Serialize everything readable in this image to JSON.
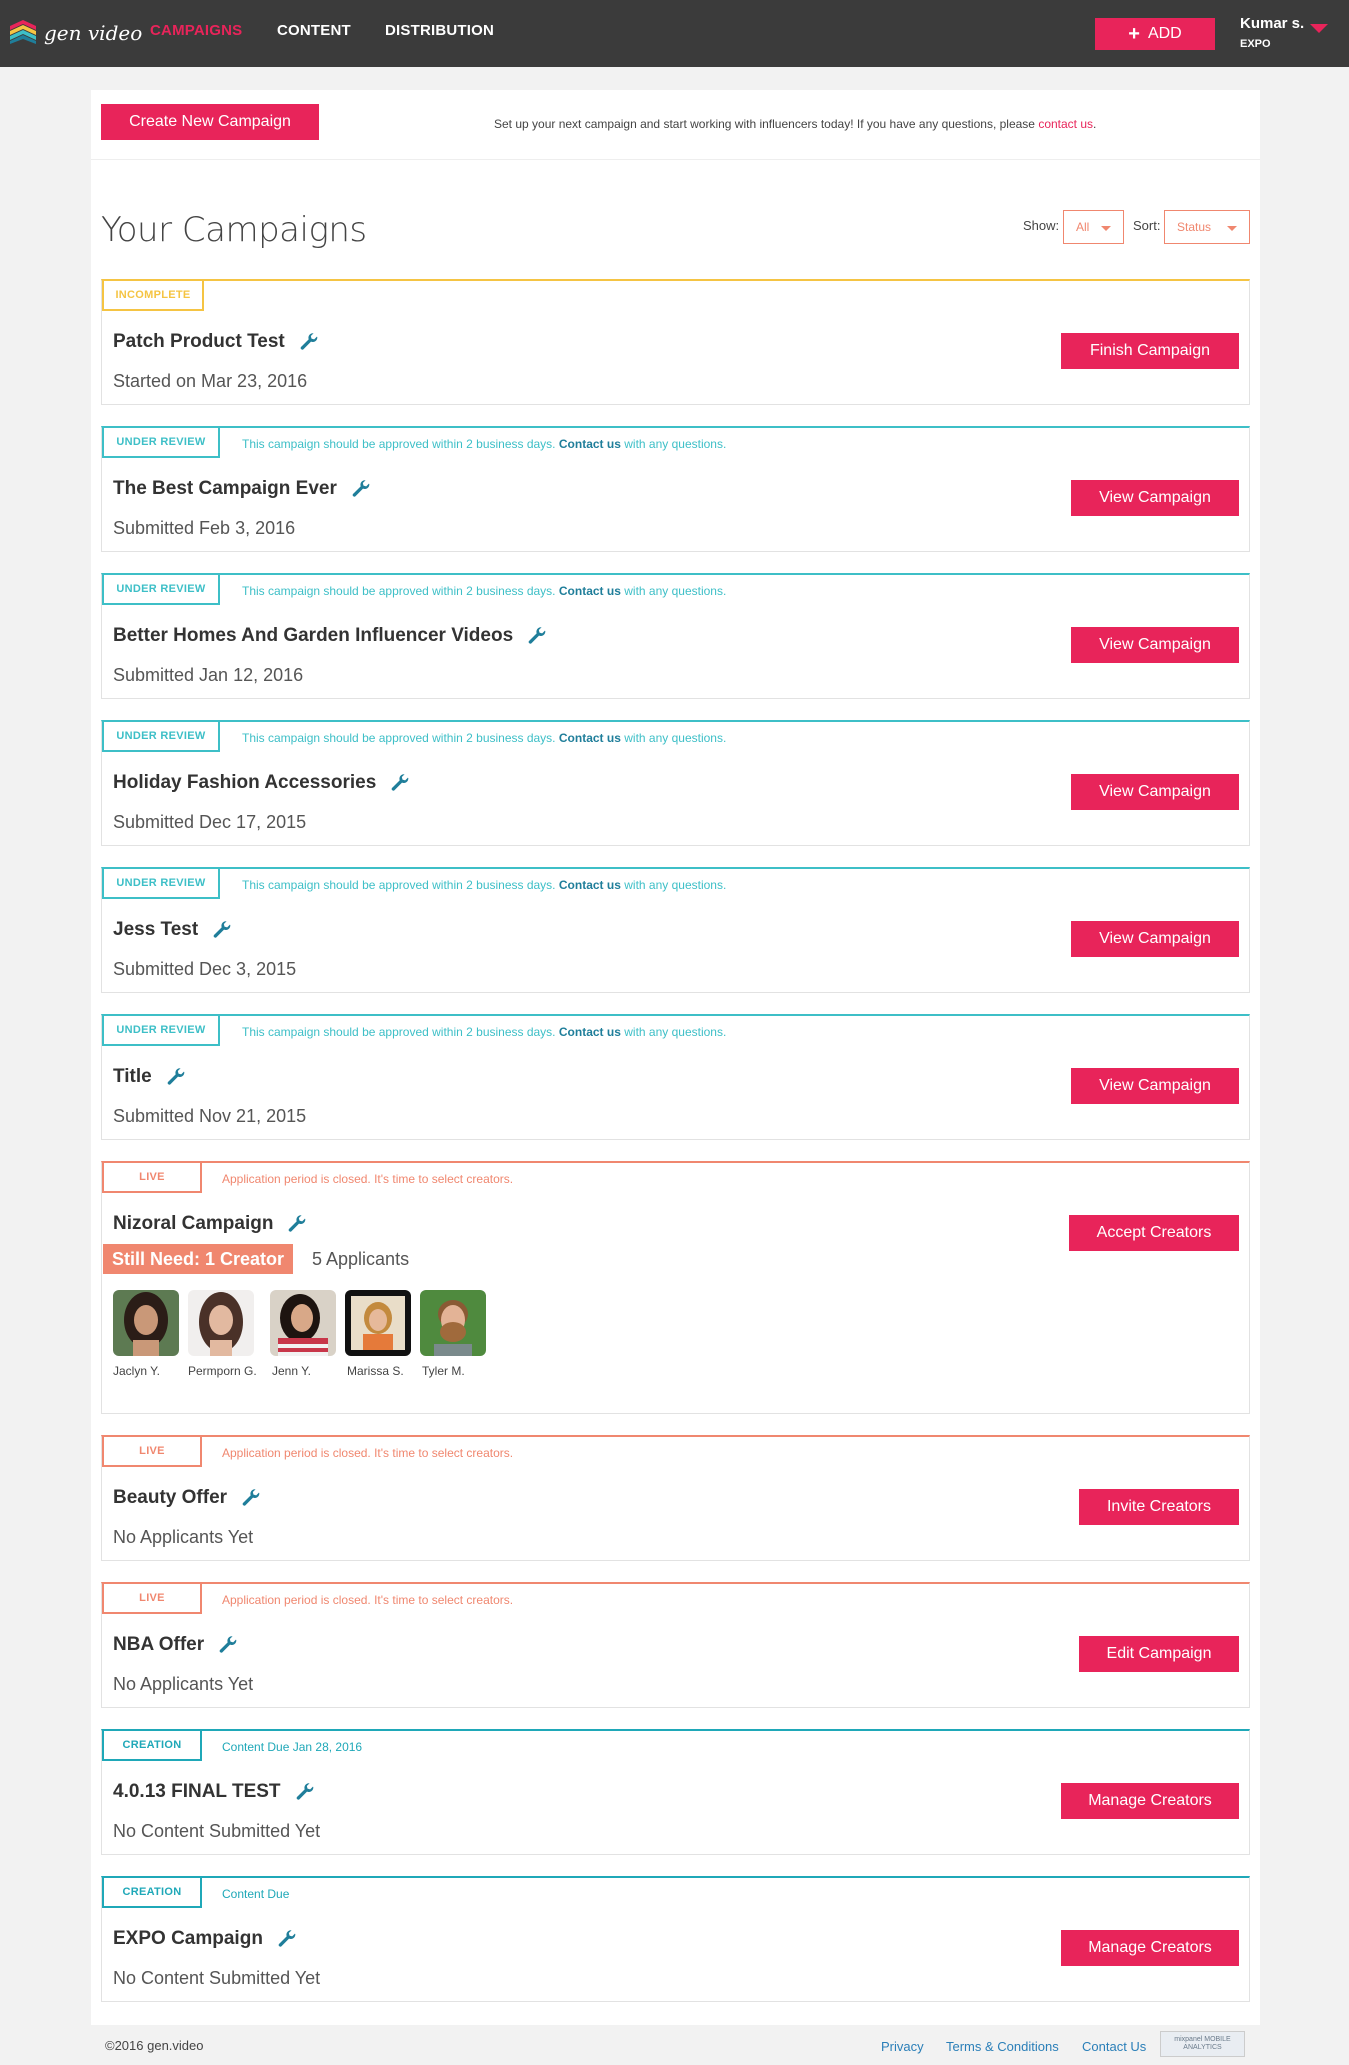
{
  "header": {
    "logo_text": "gen video",
    "nav": [
      "CAMPAIGNS",
      "CONTENT",
      "DISTRIBUTION"
    ],
    "add_label": "ADD",
    "user_name": "Kumar s.",
    "user_org": "EXPO"
  },
  "create": {
    "button_label": "Create New Campaign",
    "message": "Set up your next campaign and start working with influencers today! If you have any questions, please ",
    "message_link": "contact us",
    "message_end": "."
  },
  "campaigns_section": {
    "title": "Your Campaigns",
    "show_label": "Show:",
    "show_value": "All",
    "sort_label": "Sort:",
    "sort_value": "Status"
  },
  "campaigns": [
    {
      "status": "INCOMPLETE",
      "name": "Patch Product Test",
      "sub": "Started on Mar 23, 2016",
      "action": "Finish Campaign"
    },
    {
      "status": "UNDER REVIEW",
      "note": "This campaign should be approved within 2 business days.",
      "note_link": "Contact us",
      "note_end": "with any questions.",
      "name": "The Best Campaign Ever",
      "sub": "Submitted Feb 3, 2016",
      "action": "View Campaign"
    },
    {
      "status": "UNDER REVIEW",
      "note": "This campaign should be approved within 2 business days.",
      "note_link": "Contact us",
      "note_end": "with any questions.",
      "name": "Better Homes And Garden Influencer Videos",
      "sub": "Submitted Jan 12, 2016",
      "action": "View Campaign"
    },
    {
      "status": "UNDER REVIEW",
      "note": "This campaign should be approved within 2 business days.",
      "note_link": "Contact us",
      "note_end": "with any questions.",
      "name": "Holiday Fashion Accessories",
      "sub": "Submitted Dec 17, 2015",
      "action": "View Campaign"
    },
    {
      "status": "UNDER REVIEW",
      "note": "This campaign should be approved within 2 business days.",
      "note_link": "Contact us",
      "note_end": "with any questions.",
      "name": "Jess Test",
      "sub": "Submitted Dec 3, 2015",
      "action": "View Campaign"
    },
    {
      "status": "UNDER REVIEW",
      "note": "This campaign should be approved within 2 business days.",
      "note_link": "Contact us",
      "note_end": "with any questions.",
      "name": "Title",
      "sub": "Submitted Nov 21, 2015",
      "action": "View Campaign"
    },
    {
      "status": "LIVE",
      "note": "Application period is closed. It's time to select creators.",
      "name": "Nizoral Campaign",
      "need": "Still Need: 1 Creator",
      "applicants": "5 Applicants",
      "action": "Accept Creators",
      "creators": [
        "Jaclyn Y.",
        "Permporn G.",
        "Jenn Y.",
        "Marissa S.",
        "Tyler M."
      ]
    },
    {
      "status": "LIVE",
      "note": "Application period is closed. It's time to select creators.",
      "name": "Beauty Offer",
      "sub": "No Applicants Yet",
      "action": "Invite Creators"
    },
    {
      "status": "LIVE",
      "note": "Application period is closed. It's time to select creators.",
      "name": "NBA Offer",
      "sub": "No Applicants Yet",
      "action": "Edit Campaign"
    },
    {
      "status": "CREATION",
      "note": "Content Due Jan 28, 2016",
      "name": "4.0.13 FINAL TEST",
      "sub": "No Content Submitted Yet",
      "action": "Manage Creators"
    },
    {
      "status": "CREATION",
      "note": "Content Due",
      "name": "EXPO Campaign",
      "sub": "No Content Submitted Yet",
      "action": "Manage Creators"
    }
  ],
  "footer": {
    "copyright": "©2016 gen.video",
    "links": [
      "Privacy",
      "Terms & Conditions",
      "Contact Us"
    ],
    "badge": "mixpanel MOBILE ANALYTICS"
  },
  "colors": {
    "brand": "#e8245a",
    "incomplete": "#f5c443",
    "review": "#3dbfc7",
    "live": "#f0876f",
    "creation": "#1fa8b8",
    "topbar": "#3b3b3b"
  }
}
